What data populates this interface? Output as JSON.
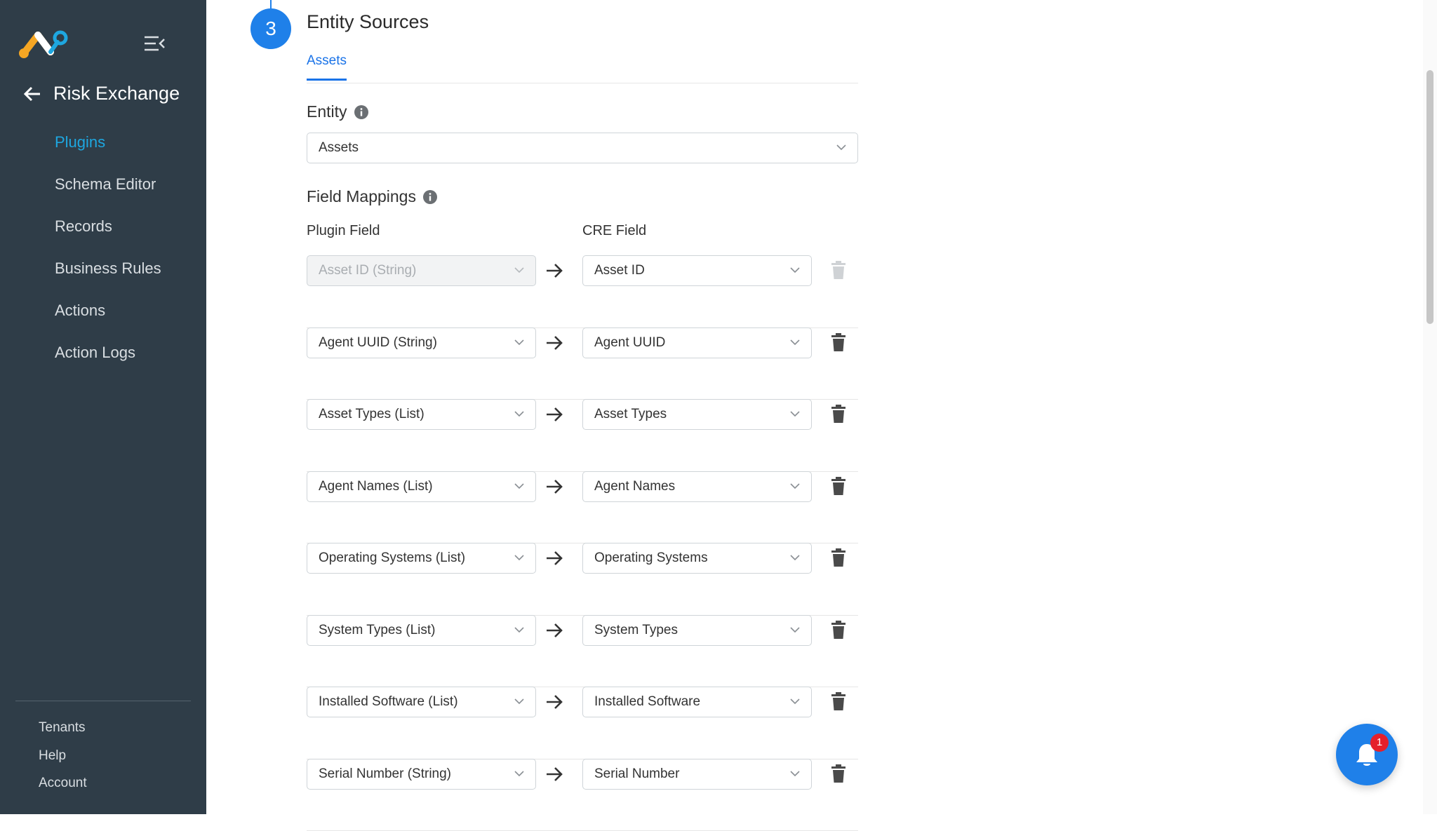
{
  "sidebar": {
    "title": "Risk Exchange",
    "nav": [
      {
        "label": "Plugins",
        "active": true
      },
      {
        "label": "Schema Editor"
      },
      {
        "label": "Records"
      },
      {
        "label": "Business Rules"
      },
      {
        "label": "Actions"
      },
      {
        "label": "Action Logs"
      }
    ],
    "bottom": [
      {
        "label": "Tenants"
      },
      {
        "label": "Help"
      },
      {
        "label": "Account"
      }
    ]
  },
  "main": {
    "step_number": "3",
    "section_title": "Entity Sources",
    "tabs": [
      {
        "label": "Assets"
      }
    ],
    "entity": {
      "label": "Entity",
      "selected": "Assets"
    },
    "field_mappings": {
      "label": "Field Mappings",
      "plugin_field_header": "Plugin Field",
      "cre_field_header": "CRE Field",
      "rows": [
        {
          "plugin": "Asset ID (String)",
          "cre": "Asset ID"
        },
        {
          "plugin": "Agent UUID (String)",
          "cre": "Agent UUID"
        },
        {
          "plugin": "Asset Types (List)",
          "cre": "Asset Types"
        },
        {
          "plugin": "Agent Names (List)",
          "cre": "Agent Names"
        },
        {
          "plugin": "Operating Systems (List)",
          "cre": "Operating Systems"
        },
        {
          "plugin": "System Types (List)",
          "cre": "System Types"
        },
        {
          "plugin": "Installed Software (List)",
          "cre": "Installed Software"
        },
        {
          "plugin": "Serial Number (String)",
          "cre": "Serial Number"
        }
      ]
    }
  },
  "notifications": {
    "count": "1"
  },
  "colors": {
    "accent": "#1f80e9",
    "sidebar_bg": "#2f3d48",
    "active_nav": "#1ea7e0",
    "badge": "#e5202b"
  }
}
